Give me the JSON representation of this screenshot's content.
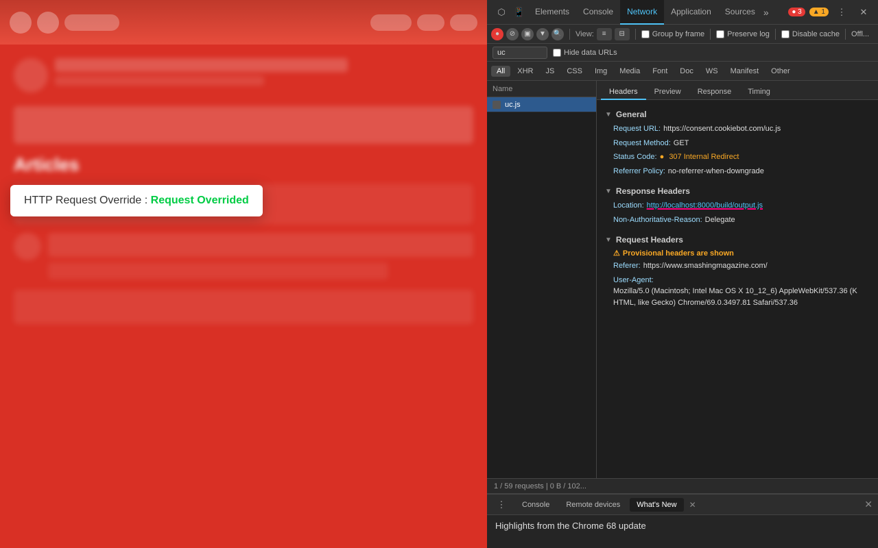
{
  "bg": {
    "articles_label": "Articles"
  },
  "tooltip": {
    "text": "HTTP Request Override : ",
    "highlight": "Request Overrided"
  },
  "devtools": {
    "tabs": [
      {
        "id": "elements",
        "label": "Elements",
        "active": false
      },
      {
        "id": "console",
        "label": "Console",
        "active": false
      },
      {
        "id": "network",
        "label": "Network",
        "active": true
      },
      {
        "id": "application",
        "label": "Application",
        "active": false
      },
      {
        "id": "sources",
        "label": "Sources",
        "active": false
      }
    ],
    "more_tabs_icon": "»",
    "badges": {
      "errors": "● 3",
      "warnings": "▲ 1"
    },
    "toolbar": {
      "record_label": "●",
      "clear_label": "🚫",
      "camera_label": "📷",
      "filter_label": "▼",
      "search_label": "🔍",
      "view_label": "View:",
      "group_by_frame": "Group by frame",
      "preserve_log": "Preserve log",
      "disable_cache": "Disable cache",
      "offline": "Offl..."
    },
    "search": {
      "value": "uc",
      "hide_data_urls": "Hide data URLs"
    },
    "filter_tabs": [
      "All",
      "XHR",
      "JS",
      "CSS",
      "Img",
      "Media",
      "Font",
      "Doc",
      "WS",
      "Manifest",
      "Other"
    ],
    "filter_active": "All",
    "request_list": {
      "header": "Name",
      "items": [
        {
          "name": "uc.js",
          "selected": true
        }
      ]
    },
    "sub_tabs": [
      "Headers",
      "Preview",
      "Response",
      "Timing"
    ],
    "sub_tab_active": "Headers",
    "headers": {
      "general": {
        "title": "General",
        "rows": [
          {
            "key": "Request URL:",
            "value": "https://consent.cookiebot.com/uc.js",
            "style": "normal"
          },
          {
            "key": "Request Method:",
            "value": "GET",
            "style": "normal"
          },
          {
            "key": "Status Code:",
            "value": "● 307 Internal Redirect",
            "style": "highlight_yellow",
            "has_dot": true,
            "dot_color": "#f9a825"
          },
          {
            "key": "Referrer Policy:",
            "value": "no-referrer-when-downgrade",
            "style": "normal"
          }
        ]
      },
      "response_headers": {
        "title": "Response Headers",
        "rows": [
          {
            "key": "Location:",
            "value": "http://localhost:8000/build/output.js",
            "style": "url_highlight",
            "underline": true
          },
          {
            "key": "Non-Authoritative-Reason:",
            "value": "Delegate",
            "style": "normal"
          }
        ]
      },
      "request_headers": {
        "title": "Request Headers",
        "warning": "⚠ Provisional headers are shown",
        "rows": [
          {
            "key": "Referer:",
            "value": "https://www.smashingmagazine.com/",
            "style": "normal"
          },
          {
            "key": "User-Agent:",
            "value": "Mozilla/5.0 (Macintosh; Intel Mac OS X 10_12_6) AppleWebKit/537.36 (KHTML, like Gecko) Chrome/69.0.3497.81 Safari/537.36",
            "style": "normal"
          }
        ]
      }
    },
    "status_bar": "1 / 59 requests | 0 B / 102...",
    "drawer": {
      "tabs": [
        {
          "label": "Console",
          "active": false
        },
        {
          "label": "Remote devices",
          "active": false
        },
        {
          "label": "What's New",
          "active": true,
          "closable": true
        }
      ],
      "content": "Highlights from the Chrome 68 update"
    }
  }
}
